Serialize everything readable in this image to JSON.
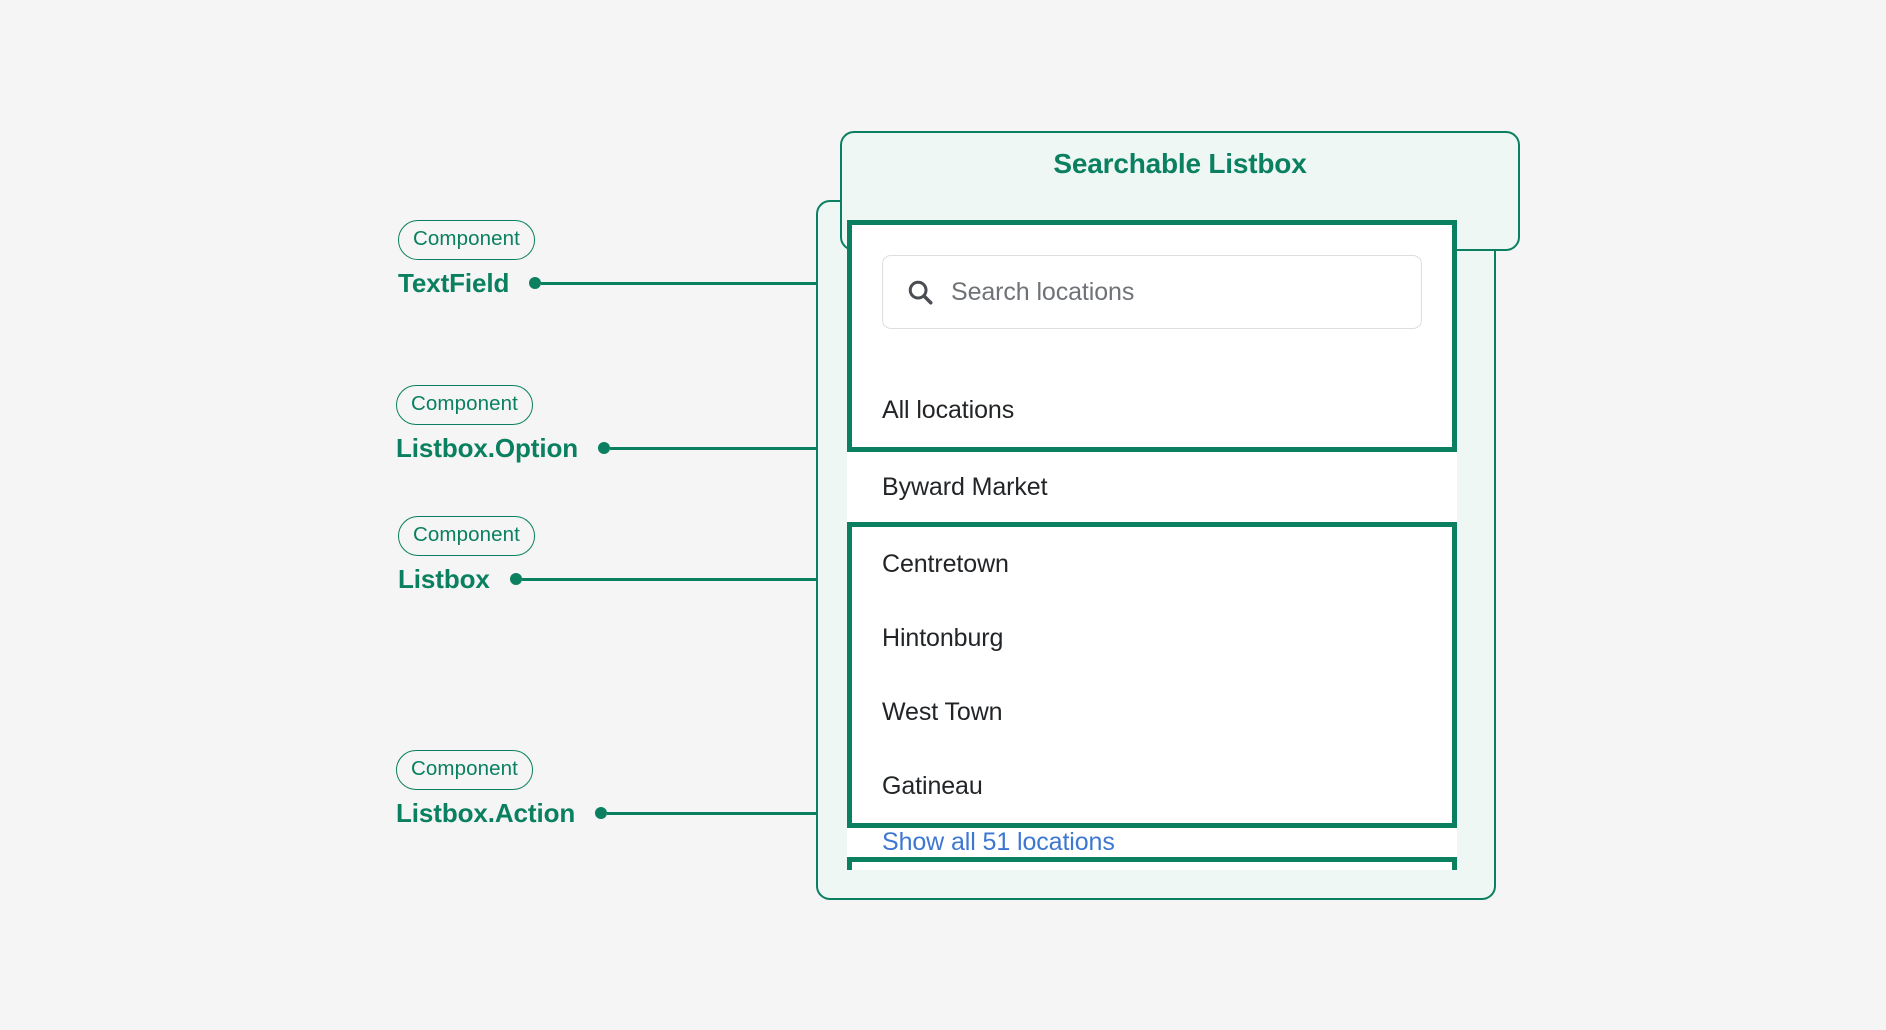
{
  "card": {
    "title": "Searchable Listbox",
    "accent_color": "#0a8060",
    "panel_fill": "#eff7f4",
    "page_background": "#f4f5f4"
  },
  "search": {
    "icon": "search-icon",
    "placeholder": "Search locations",
    "value": ""
  },
  "listbox": {
    "options": [
      {
        "label": "All locations",
        "annotated": false
      },
      {
        "label": "Byward Market",
        "annotated": true
      },
      {
        "label": "Centretown",
        "annotated": false
      },
      {
        "label": "Hintonburg",
        "annotated": false
      },
      {
        "label": "West Town",
        "annotated": false
      },
      {
        "label": "Gatineau",
        "annotated": false
      }
    ],
    "action": {
      "label": "Show all 51 locations",
      "color": "#3d77d1"
    }
  },
  "annotations": [
    {
      "badge": "Component",
      "name": "TextField"
    },
    {
      "badge": "Component",
      "name": "Listbox.Option"
    },
    {
      "badge": "Component",
      "name": "Listbox"
    },
    {
      "badge": "Component",
      "name": "Listbox.Action"
    }
  ]
}
